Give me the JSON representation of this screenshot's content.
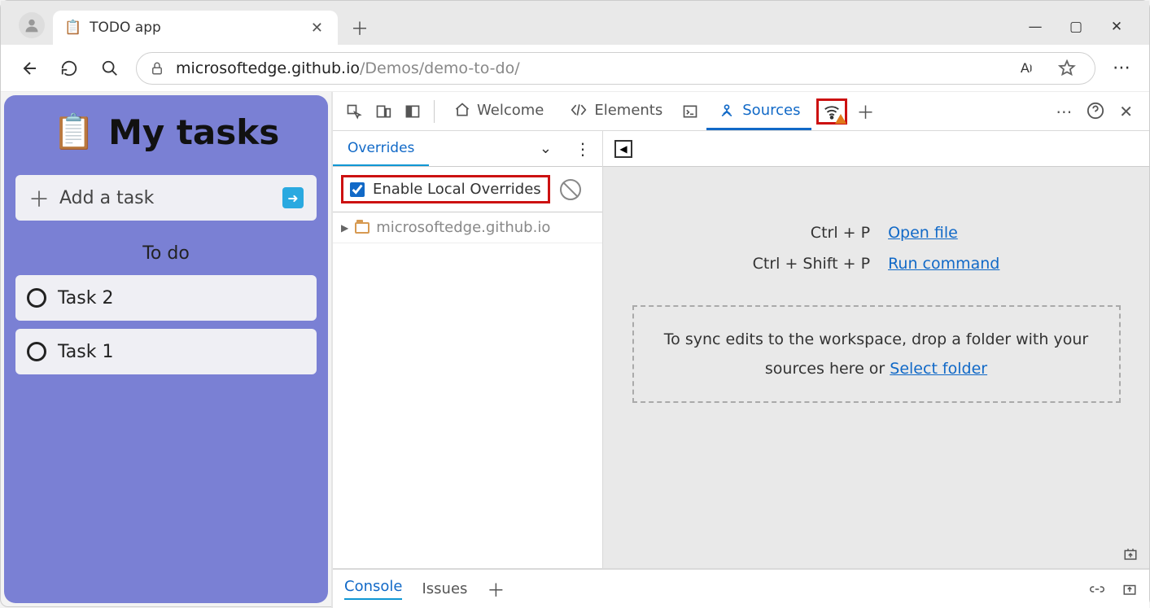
{
  "browser": {
    "tab_title": "TODO app",
    "url_host": "microsoftedge.github.io",
    "url_path": "/Demos/demo-to-do/"
  },
  "app": {
    "title": "My tasks",
    "add_placeholder": "Add a task",
    "section": "To do",
    "tasks": [
      "Task 2",
      "Task 1"
    ]
  },
  "devtools": {
    "tabs": {
      "welcome": "Welcome",
      "elements": "Elements",
      "sources": "Sources"
    },
    "overrides_tab": "Overrides",
    "enable_overrides": "Enable Local Overrides",
    "domain": "microsoftedge.github.io",
    "shortcuts": {
      "open_key": "Ctrl + P",
      "open_label": "Open file",
      "run_key": "Ctrl + Shift + P",
      "run_label": "Run command"
    },
    "dropzone_pre": "To sync edits to the workspace, drop a folder with your sources here or ",
    "dropzone_link": "Select folder",
    "drawer": {
      "console": "Console",
      "issues": "Issues"
    }
  }
}
